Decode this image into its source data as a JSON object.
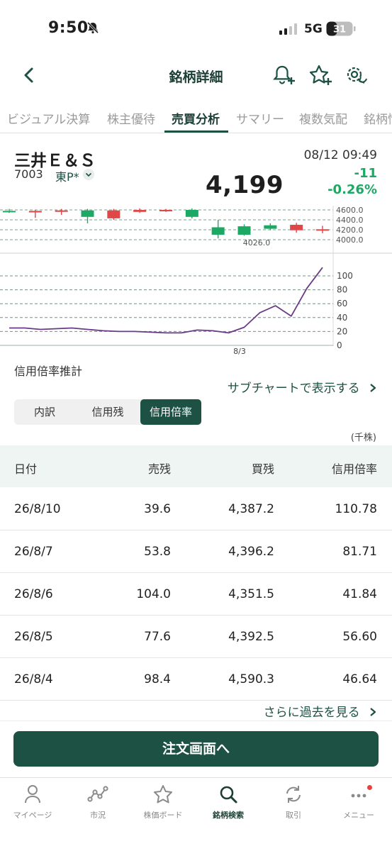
{
  "status": {
    "time": "9:50",
    "network": "5G",
    "battery": "31"
  },
  "header": {
    "title": "銘柄詳細"
  },
  "tabs": [
    {
      "label": "ビジュアル決算"
    },
    {
      "label": "株主優待"
    },
    {
      "label": "売買分析"
    },
    {
      "label": "サマリー"
    },
    {
      "label": "複数気配"
    },
    {
      "label": "銘柄情"
    }
  ],
  "stock": {
    "name": "三井Ｅ＆Ｓ",
    "code": "7003",
    "market": "東P*",
    "price": "4,199",
    "datetime": "08/12 09:49",
    "change": "-11",
    "change_pct": "-0.26%",
    "up_color": "#1da864",
    "down_color": "#e04848"
  },
  "chart_data": [
    {
      "type": "candlestick",
      "y_ticks": [
        "4600.0",
        "4400.0",
        "4200.0",
        "4000.0"
      ],
      "annotation": "4026.0",
      "ylim": [
        3950,
        4650
      ],
      "candles": [
        {
          "open": 4560,
          "close": 4580,
          "high": 4620,
          "low": 4540
        },
        {
          "open": 4580,
          "close": 4550,
          "high": 4600,
          "low": 4440
        },
        {
          "open": 4590,
          "close": 4585,
          "high": 4620,
          "low": 4500
        },
        {
          "open": 4460,
          "close": 4590,
          "high": 4620,
          "low": 4330
        },
        {
          "open": 4590,
          "close": 4430,
          "high": 4620,
          "low": 4400
        },
        {
          "open": 4600,
          "close": 4560,
          "high": 4630,
          "low": 4540
        },
        {
          "open": 4600,
          "close": 4580,
          "high": 4620,
          "low": 4560
        },
        {
          "open": 4460,
          "close": 4600,
          "high": 4630,
          "low": 4430
        },
        {
          "open": 4100,
          "close": 4250,
          "high": 4400,
          "low": 4026
        },
        {
          "open": 4100,
          "close": 4270,
          "high": 4310,
          "low": 4080
        },
        {
          "open": 4220,
          "close": 4290,
          "high": 4330,
          "low": 4190
        },
        {
          "open": 4300,
          "close": 4190,
          "high": 4340,
          "low": 4140
        },
        {
          "open": 4210,
          "close": 4199,
          "high": 4280,
          "low": 4130
        }
      ]
    },
    {
      "type": "line",
      "y_ticks": [
        "100",
        "80",
        "60",
        "40",
        "20",
        "0"
      ],
      "x_label": "8/3",
      "ylim": [
        0,
        110
      ],
      "values": [
        25,
        25,
        23,
        24,
        25,
        23,
        21,
        20,
        20,
        19,
        18,
        18,
        22,
        21,
        18,
        26,
        47,
        57,
        42,
        82,
        112
      ]
    }
  ],
  "sub_label": "信用倍率推計",
  "sub_link": "サブチャートで表示する",
  "segments": [
    {
      "label": "内訳"
    },
    {
      "label": "信用残"
    },
    {
      "label": "信用倍率"
    }
  ],
  "unit": "(千株)",
  "table": {
    "headers": [
      "日付",
      "売残",
      "買残",
      "信用倍率"
    ],
    "rows": [
      [
        "26/8/10",
        "39.6",
        "4,387.2",
        "110.78"
      ],
      [
        "26/8/7",
        "53.8",
        "4,396.2",
        "81.71"
      ],
      [
        "26/8/6",
        "104.0",
        "4,351.5",
        "41.84"
      ],
      [
        "26/8/5",
        "77.6",
        "4,392.5",
        "56.60"
      ],
      [
        "26/8/4",
        "98.4",
        "4,590.3",
        "46.64"
      ]
    ]
  },
  "more_link": "さらに過去を見る",
  "order_button": "注文画面へ",
  "bottom_nav": [
    {
      "label": "マイページ",
      "icon": "person-icon"
    },
    {
      "label": "市況",
      "icon": "market-icon"
    },
    {
      "label": "株価ボード",
      "icon": "star-icon"
    },
    {
      "label": "銘柄検索",
      "icon": "search-icon"
    },
    {
      "label": "取引",
      "icon": "refresh-icon"
    },
    {
      "label": "メニュー",
      "icon": "more-icon"
    }
  ]
}
